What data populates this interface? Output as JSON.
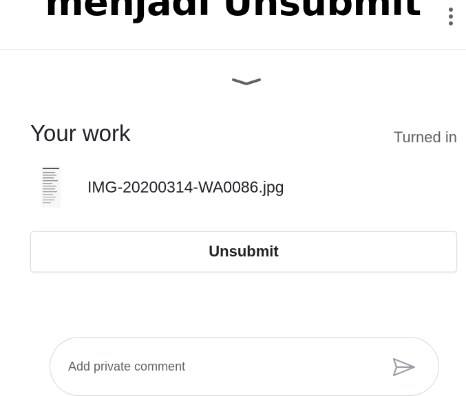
{
  "overlay": {
    "title": "menjadi Unsubmit"
  },
  "header": {
    "menu_icon": "more-vert-icon"
  },
  "sheet": {
    "handle_icon": "chevron-down-icon"
  },
  "your_work": {
    "title": "Your work",
    "status": "Turned in",
    "attachments": [
      {
        "filename": "IMG-20200314-WA0086.jpg",
        "icon": "image-thumbnail"
      }
    ],
    "unsubmit_label": "Unsubmit"
  },
  "private_comment": {
    "placeholder": "Add private comment",
    "value": "",
    "send_icon": "send-icon"
  },
  "colors": {
    "text_primary": "#202124",
    "text_secondary": "#5f6368",
    "border": "#dadce0",
    "divider": "#e0e0e0",
    "icon_muted": "#9aa0a6"
  }
}
